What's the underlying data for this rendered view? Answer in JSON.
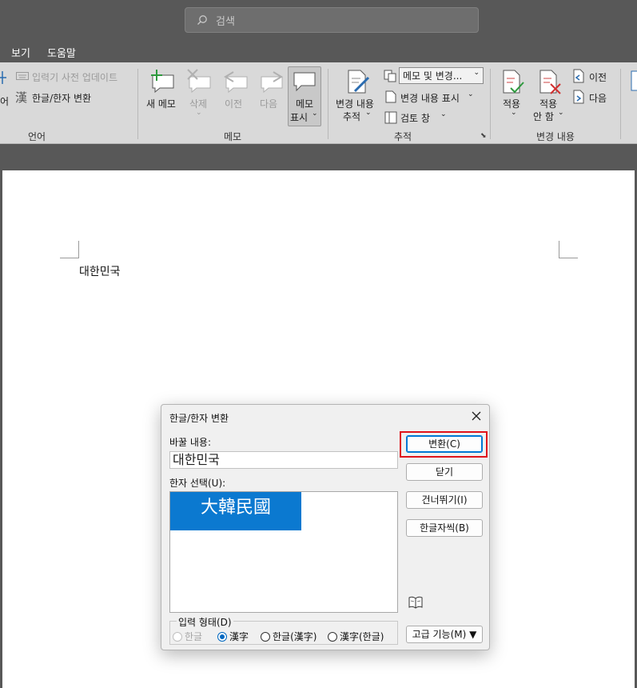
{
  "titlebar": {
    "search_placeholder": "검색"
  },
  "menu": {
    "tabs": [
      "보기",
      "도움말"
    ]
  },
  "ribbon": {
    "language": {
      "ime_update": "입력기 사전 업데이트",
      "hanja_convert": "한글/한자 변환",
      "partial_left": "어",
      "group": "언어"
    },
    "memo": {
      "new": "새 메모",
      "delete": "삭제",
      "prev": "이전",
      "next": "다음",
      "show_line1": "메모",
      "show_line2": "표시",
      "group": "메모"
    },
    "tracking": {
      "track_line1": "변경 내용",
      "track_line2": "추적",
      "markup_select": "메모 및 변경...",
      "show_markup": "변경 내용 표시",
      "review_pane": "검토 창",
      "group": "추적"
    },
    "changes": {
      "accept": "적용",
      "reject_line1": "적용",
      "reject_line2": "안 함",
      "prev": "이전",
      "next": "다음",
      "group": "변경 내용"
    }
  },
  "document": {
    "text": "대한민국"
  },
  "dialog": {
    "title": "한글/한자 변환",
    "replace_label": "바꿀 내용:",
    "replace_value": "대한민국",
    "hanja_label": "한자 선택(U):",
    "hanja_options": [
      "大韓民國"
    ],
    "buttons": {
      "convert": "변환(C)",
      "close": "닫기",
      "skip": "건너뛰기(I)",
      "char_by_char": "한글자씩(B)",
      "advanced": "고급 기능(M) ▼"
    },
    "input_form": {
      "legend": "입력 형태(D)",
      "options": [
        "한글",
        "漢字",
        "한글(漢字)",
        "漢字(한글)"
      ],
      "selected": "漢字"
    }
  }
}
